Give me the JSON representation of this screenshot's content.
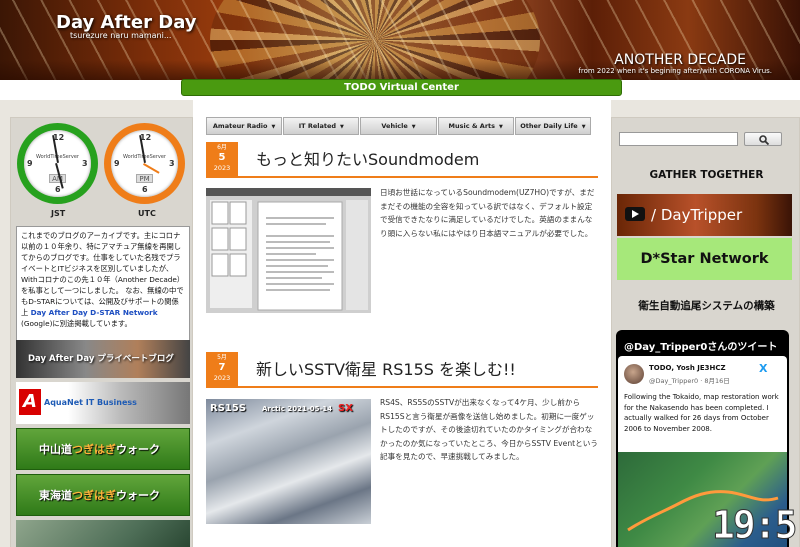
{
  "header": {
    "title": "Day After Day",
    "tagline": "tsurezure naru mamani...",
    "decade": "ANOTHER DECADE",
    "decade_sub": "from 2022 when it's begining after/with CORONA Virus.",
    "virtual_center": "TODO Virtual Center"
  },
  "clocks": [
    {
      "server": "WorldTimeServer",
      "ampm": "AM",
      "zone": "JST",
      "ring": "#27a11e"
    },
    {
      "server": "WorldTimeServer",
      "ampm": "PM",
      "zone": "UTC",
      "ring": "#ef7d19"
    }
  ],
  "archive_note": {
    "text": "これまでのブログのアーカイブです。主にコロナ以前の１０年余り、特にアマチュア無線を再開してからのブログです。仕事をしていた名残でプライベートとITビジネスを区別していましたが、Withコロナのこの先１０年（Another Decade）を私事として一つにしました。 なお、無線の中でもD-STARについては、公開及びサポートの関係上 ",
    "link1": "Day After Day D-STAR Network",
    "mid": " (Google)に別途掲載しています。"
  },
  "left_banners": {
    "private_blog": "Day After Day プライベートブログ",
    "aquanet": "AquaNet IT Business",
    "aquanet_logo": "A",
    "nakasendo_a": "中山道",
    "nakasendo_b": "つぎはぎ",
    "nakasendo_c": "ウォーク",
    "tokaido_a": "東海道",
    "tokaido_b": "つぎはぎ",
    "tokaido_c": "ウォーク"
  },
  "nav": [
    {
      "label": "Amateur Radio",
      "arrow": "▼"
    },
    {
      "label": "IT Related",
      "arrow": "▼"
    },
    {
      "label": "Vehicle",
      "arrow": "▼"
    },
    {
      "label": "Music & Arts",
      "arrow": "▼"
    },
    {
      "label": "Other Daily Life",
      "arrow": "▼"
    }
  ],
  "posts": [
    {
      "month": "6月",
      "day": "5",
      "year": "2023",
      "title": "もっと知りたいSoundmodem",
      "excerpt": "日頃お世話になっているSoundmodem(UZ7HO)ですが、まだまだその機能の全容を知っている訳ではなく、デフォルト設定で受信できたなりに満足しているだけでした。英語のままんなり頭に入らない私にはやはり日本語マニュアルが必要でした。"
    },
    {
      "month": "5月",
      "day": "7",
      "year": "2023",
      "title": "新しいSSTV衛星 RS15S を楽しむ!!",
      "excerpt": "RS4S、RS5SのSSTVが出来なくなって4ケ月、少し前からRS15Sと言う衛星が画像を送信し始めました。初期に一度ゲットしたのですが、その後途切れていたのかタイミングが合わなかったのか気になっていたところ、今日からSSTV Eventという記事を見たので、早速挑戦してみました。",
      "thumb_callsign": "RS15S",
      "thumb_date": "Arctic 2021-05-14",
      "thumb_mode": "SX"
    }
  ],
  "right": {
    "gather": "GATHER TOGETHER",
    "daytripper": "/ DayTripper",
    "dstar": "D*Star Network",
    "satellite": "衛生自動追尾システムの構築",
    "tweets_header": "@Day_Tripper0さんのツイート",
    "tweet_name": "TODO, Yosh JE3HCZ",
    "tweet_handle": "@Day_Tripper0 · 8月16日",
    "tweet_x": "X",
    "tweet_text": "Following the Tokaido, map restoration work for the Nakasendo has been completed. I actually walked for 26 days from October 2006 to November 2008."
  },
  "overlay_time": "19:5"
}
